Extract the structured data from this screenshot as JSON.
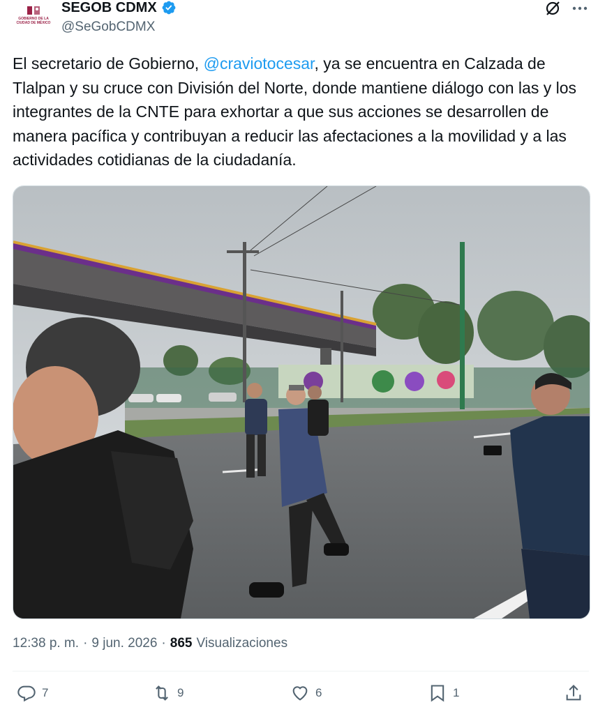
{
  "header": {
    "display_name": "SEGOB CDMX",
    "handle": "@SeGobCDMX",
    "avatar_text": "GOBIERNO DE LA CIUDAD DE MÉXICO",
    "grok_icon": "grok-slash-icon",
    "more_icon": "more-dots-icon",
    "verified_color": "#1d9bf0"
  },
  "tweet": {
    "text_before": "El secretario de Gobierno, ",
    "mention": "@craviotocesar",
    "text_after": ", ya se encuentra en Calzada de Tlalpan y su cruce con División del Norte, donde mantiene diálogo con las y los integrantes de la CNTE para exhortar a que sus acciones se desarrollen de manera pacífica y contribuyan a reducir las afectaciones a la movilidad y a las actividades cotidianas de la ciudadanía.",
    "mention_color": "#1d9bf0"
  },
  "meta": {
    "time": "12:38 p. m.",
    "sep1": "·",
    "date": "9 jun. 2026",
    "sep2": "·",
    "views_count": "865",
    "views_label": "Visualizaciones"
  },
  "actions": {
    "replies": "7",
    "reposts": "9",
    "likes": "6",
    "bookmarks": "1",
    "icons": [
      "reply-icon",
      "repost-icon",
      "like-icon",
      "bookmark-icon",
      "share-icon"
    ]
  }
}
